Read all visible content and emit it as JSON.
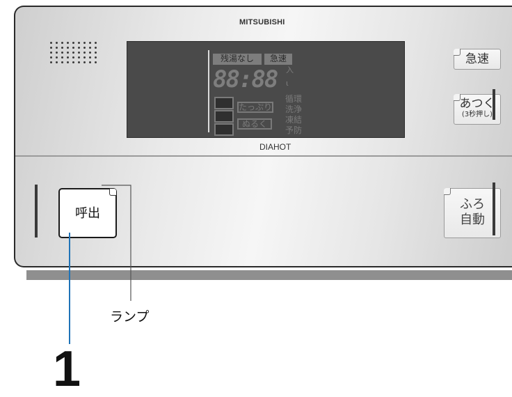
{
  "panel": {
    "brand": "MITSUBISHI",
    "model": "DIAHOT"
  },
  "display": {
    "zanyu_label": "残湯なし",
    "kyusoku_label": "急速",
    "digits": "88:88",
    "iri_label": "入",
    "unit_label": "ι",
    "tappuri_label": "たっぷり",
    "nuruku_label": "ぬるく",
    "junkan_label": "循環",
    "senjo_label": "洗浄",
    "toketsu_label": "凍結",
    "yobo_label": "予防"
  },
  "buttons": {
    "kyusoku": "急速",
    "atsuku_main": "あつく",
    "atsuku_sub": "(3秒押し)",
    "furo_line1": "ふろ",
    "furo_line2": "自動",
    "yobidashi": "呼出"
  },
  "callouts": {
    "lamp": "ランプ",
    "number": "1"
  },
  "colors": {
    "leader_blue": "#1f73b7",
    "leader_gray": "#555555"
  }
}
